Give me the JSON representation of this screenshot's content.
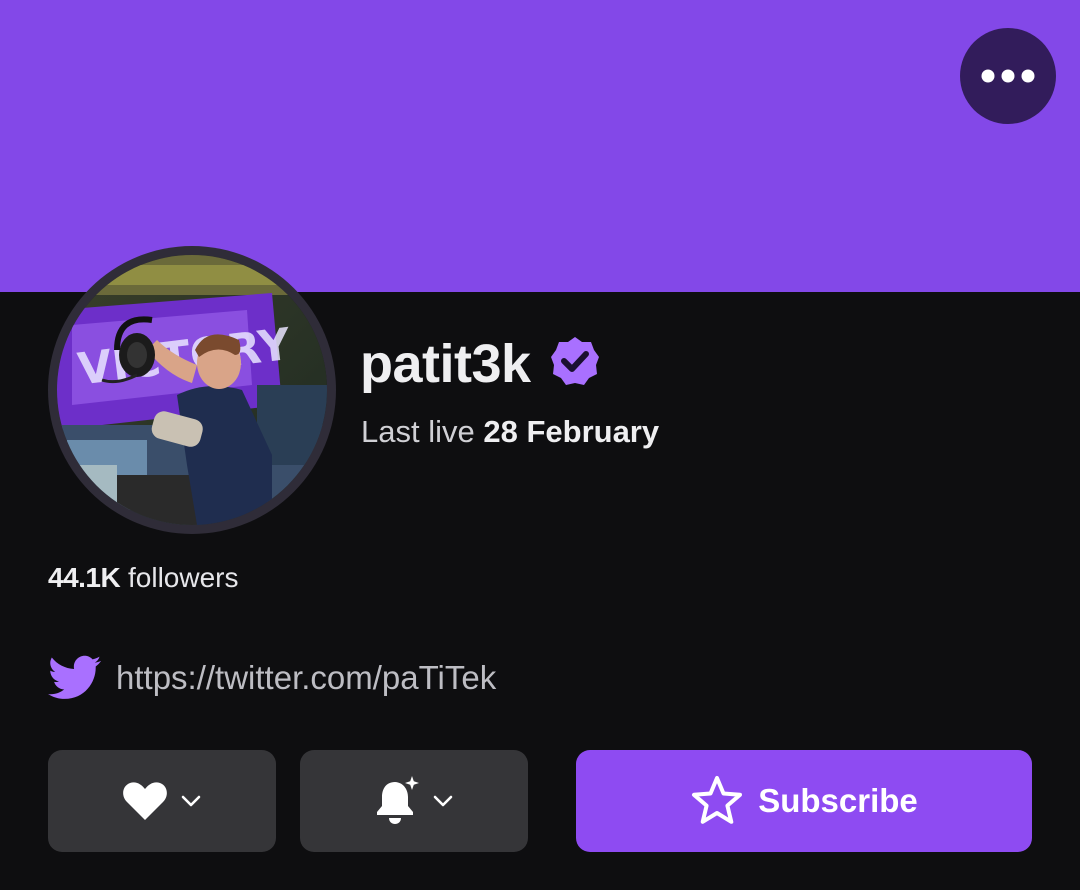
{
  "header": {
    "banner_color": "#8348e8",
    "more_button_icon": "more-horizontal-icon"
  },
  "profile": {
    "username": "patit3k",
    "verified_icon": "verified-badge-icon",
    "last_live_prefix": "Last live",
    "last_live_date": "28 February",
    "followers_count": "44.1K",
    "followers_label": "followers"
  },
  "social": {
    "icon": "twitter-icon",
    "link_text": "https://twitter.com/paTiTek"
  },
  "actions": {
    "follow_icon": "heart-icon",
    "notify_icon": "bell-icon",
    "subscribe_icon": "star-icon",
    "subscribe_label": "Subscribe",
    "accent_color": "#8e4bf2"
  }
}
